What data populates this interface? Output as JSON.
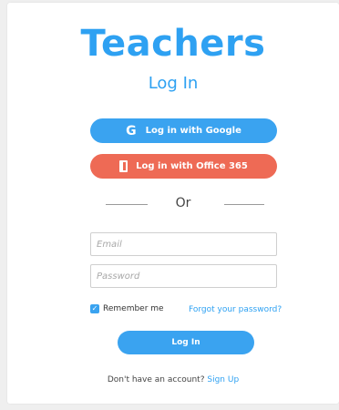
{
  "header": {
    "title": "Teachers",
    "subtitle": "Log In"
  },
  "sso": {
    "google_label": "Log in with Google",
    "google_icon": "google-g-icon",
    "google_color": "#3aa3f0",
    "office_label": "Log in with Office 365",
    "office_icon": "office-icon",
    "office_color": "#ee6a55"
  },
  "divider": {
    "text": "Or"
  },
  "form": {
    "email_placeholder": "Email",
    "email_value": "",
    "password_placeholder": "Password",
    "password_value": "",
    "remember_label": "Remember me",
    "remember_checked": true,
    "forgot_link": "Forgot your password?",
    "submit_label": "Log In"
  },
  "footer": {
    "prompt": "Don't have an account?",
    "signup_link": "Sign Up"
  },
  "colors": {
    "accent": "#2ea1f2",
    "office": "#ee6a55"
  }
}
